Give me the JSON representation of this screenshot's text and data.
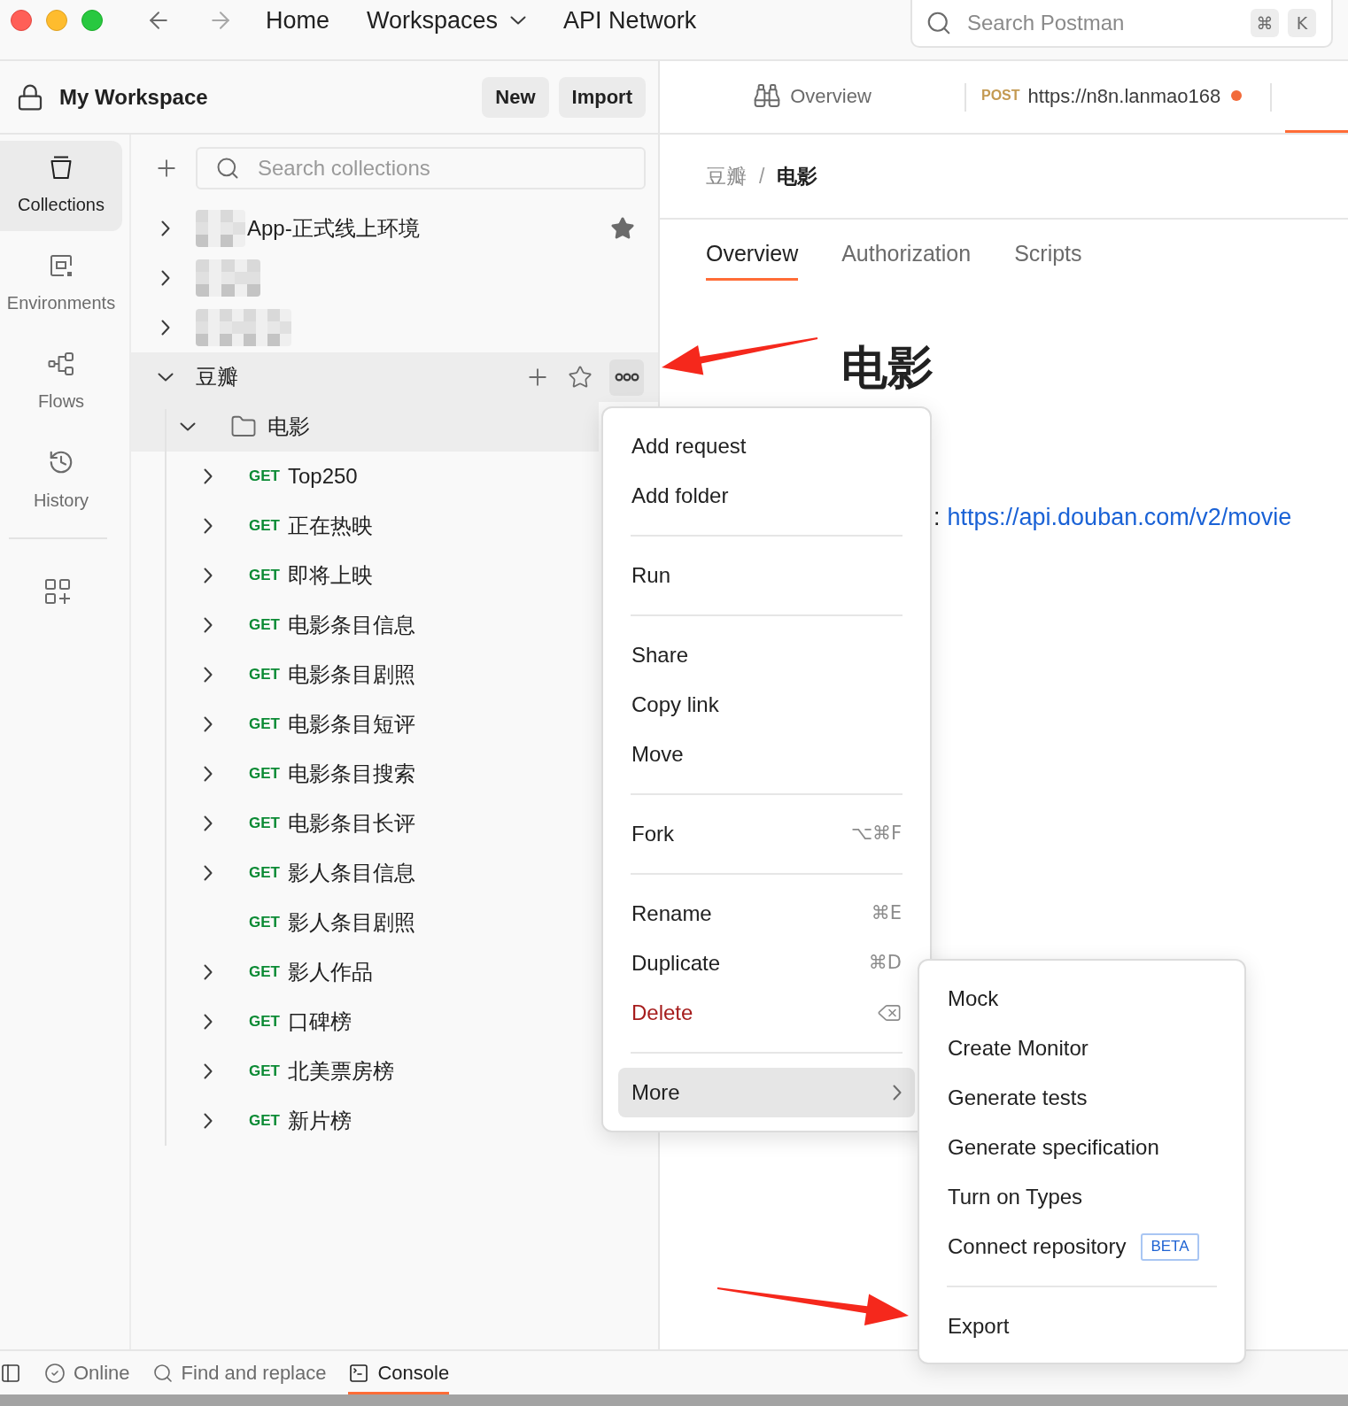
{
  "top_nav": {
    "items": [
      {
        "label": "Home",
        "dropdown": false
      },
      {
        "label": "Workspaces",
        "dropdown": true
      },
      {
        "label": "API Network",
        "dropdown": false
      }
    ],
    "search": {
      "placeholder": "Search Postman",
      "keys": [
        "⌘",
        "K"
      ]
    }
  },
  "workspace": {
    "title": "My Workspace",
    "buttons": [
      "New",
      "Import"
    ]
  },
  "tabs": [
    {
      "kind": "overview",
      "label": "Overview",
      "selected": false
    },
    {
      "kind": "request",
      "method": "POST",
      "label": "https://n8n.lanmao168",
      "unsaved": true,
      "selected": false
    },
    {
      "kind": "clipped",
      "selected": true
    }
  ],
  "sidebar_nav": [
    {
      "label": "Collections",
      "selected": true
    },
    {
      "label": "Environments",
      "selected": false
    },
    {
      "label": "Flows",
      "selected": false
    },
    {
      "label": "History",
      "selected": false
    }
  ],
  "collections": {
    "search": {
      "placeholder": "Search collections"
    },
    "items": [
      {
        "name": "App-正式线上环境",
        "redacted": true,
        "expanded": false,
        "starred": true,
        "menu_open": false,
        "selected": false
      },
      {
        "redacted": true,
        "expanded": false,
        "starred": false,
        "menu_open": false,
        "selected": false
      },
      {
        "redacted": true,
        "expanded": false,
        "starred": false,
        "menu_open": false,
        "selected": false
      },
      {
        "name": "豆瓣",
        "redacted": false,
        "expanded": true,
        "starred": false,
        "menu_open": true,
        "selected": false,
        "children": [
          {
            "kind": "folder",
            "name": "电影",
            "expanded": true,
            "selected": true,
            "children": [
              {
                "kind": "request",
                "method": "GET",
                "name": "Top250",
                "expandable": true,
                "selected": false
              },
              {
                "kind": "request",
                "method": "GET",
                "name": "正在热映",
                "expandable": true,
                "selected": false
              },
              {
                "kind": "request",
                "method": "GET",
                "name": "即将上映",
                "expandable": true,
                "selected": false
              },
              {
                "kind": "request",
                "method": "GET",
                "name": "电影条目信息",
                "expandable": true,
                "selected": false
              },
              {
                "kind": "request",
                "method": "GET",
                "name": "电影条目剧照",
                "expandable": true,
                "selected": false
              },
              {
                "kind": "request",
                "method": "GET",
                "name": "电影条目短评",
                "expandable": true,
                "selected": false
              },
              {
                "kind": "request",
                "method": "GET",
                "name": "电影条目搜索",
                "expandable": true,
                "selected": false
              },
              {
                "kind": "request",
                "method": "GET",
                "name": "电影条目长评",
                "expandable": true,
                "selected": false
              },
              {
                "kind": "request",
                "method": "GET",
                "name": "影人条目信息",
                "expandable": true,
                "selected": false
              },
              {
                "kind": "request",
                "method": "GET",
                "name": "影人条目剧照",
                "expandable": false,
                "selected": false
              },
              {
                "kind": "request",
                "method": "GET",
                "name": "影人作品",
                "expandable": true,
                "selected": false
              },
              {
                "kind": "request",
                "method": "GET",
                "name": "口碑榜",
                "expandable": true,
                "selected": false
              },
              {
                "kind": "request",
                "method": "GET",
                "name": "北美票房榜",
                "expandable": true,
                "selected": false
              },
              {
                "kind": "request",
                "method": "GET",
                "name": "新片榜",
                "expandable": true,
                "selected": false
              }
            ]
          }
        ]
      }
    ]
  },
  "breadcrumb": {
    "items": [
      "豆瓣",
      "电影"
    ],
    "separator": "/"
  },
  "detail_tabs": [
    {
      "label": "Overview",
      "selected": true
    },
    {
      "label": "Authorization",
      "selected": false
    },
    {
      "label": "Scripts",
      "selected": false
    }
  ],
  "heading": "电影",
  "base_url": {
    "prefix": ":",
    "link": "https://api.douban.com/v2/movie"
  },
  "context_menu": {
    "groups": [
      [
        {
          "label": "Add request",
          "kind": "normal",
          "highlighted": false
        },
        {
          "label": "Add folder",
          "kind": "normal",
          "highlighted": false
        }
      ],
      [
        {
          "label": "Run",
          "kind": "normal",
          "highlighted": false
        }
      ],
      [
        {
          "label": "Share",
          "kind": "normal",
          "highlighted": false
        },
        {
          "label": "Copy link",
          "kind": "normal",
          "highlighted": false
        },
        {
          "label": "Move",
          "kind": "normal",
          "highlighted": false
        }
      ],
      [
        {
          "label": "Fork",
          "kind": "normal",
          "shortcut": "⌥⌘F",
          "highlighted": false
        }
      ],
      [
        {
          "label": "Rename",
          "kind": "normal",
          "shortcut": "⌘E",
          "highlighted": false
        },
        {
          "label": "Duplicate",
          "kind": "normal",
          "shortcut": "⌘D",
          "highlighted": false
        },
        {
          "label": "Delete",
          "kind": "danger",
          "highlighted": false
        }
      ],
      [
        {
          "label": "More",
          "kind": "submenu",
          "highlighted": true
        }
      ]
    ]
  },
  "submenu": {
    "groups": [
      [
        {
          "label": "Mock"
        },
        {
          "label": "Create Monitor"
        },
        {
          "label": "Generate tests"
        },
        {
          "label": "Generate specification"
        },
        {
          "label": "Turn on Types"
        },
        {
          "label": "Connect repository",
          "badge": "BETA"
        }
      ],
      [
        {
          "label": "Export"
        }
      ]
    ]
  },
  "status_bar": [
    {
      "label": "Online",
      "selected": false
    },
    {
      "label": "Find and replace",
      "selected": false
    },
    {
      "label": "Console",
      "selected": true
    }
  ]
}
